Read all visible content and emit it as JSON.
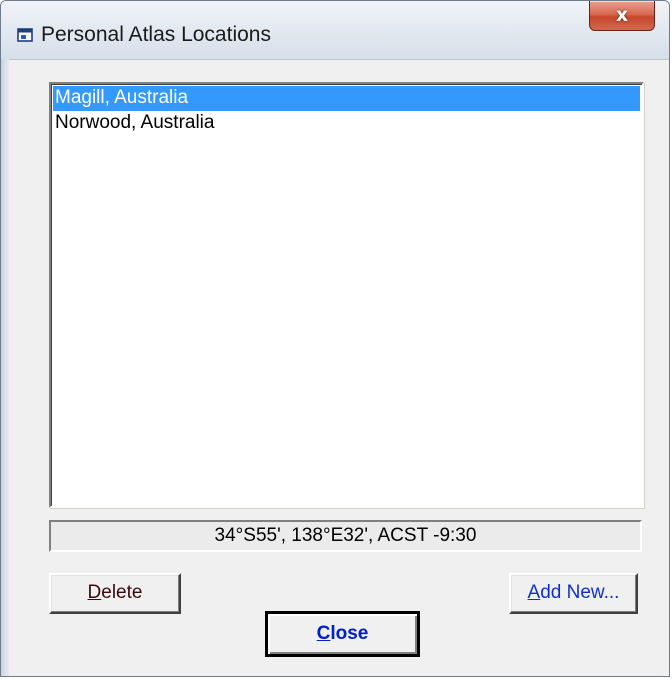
{
  "window": {
    "title": "Personal Atlas Locations",
    "close_glyph": "x"
  },
  "locations": {
    "items": [
      {
        "label": "Magill, Australia",
        "selected": true
      },
      {
        "label": "Norwood, Australia",
        "selected": false
      }
    ]
  },
  "status": {
    "text": "34°S55', 138°E32', ACST -9:30"
  },
  "buttons": {
    "delete": {
      "mnemonic": "D",
      "rest": "elete"
    },
    "add_new": {
      "mnemonic": "A",
      "rest": "dd New..."
    },
    "close": {
      "mnemonic": "C",
      "rest": "lose"
    }
  },
  "colors": {
    "selection": "#3399ff",
    "close_label": "#0020c8",
    "add_label": "#1030c8"
  },
  "icons": {
    "app": "window-app-icon",
    "close": "close-icon"
  }
}
